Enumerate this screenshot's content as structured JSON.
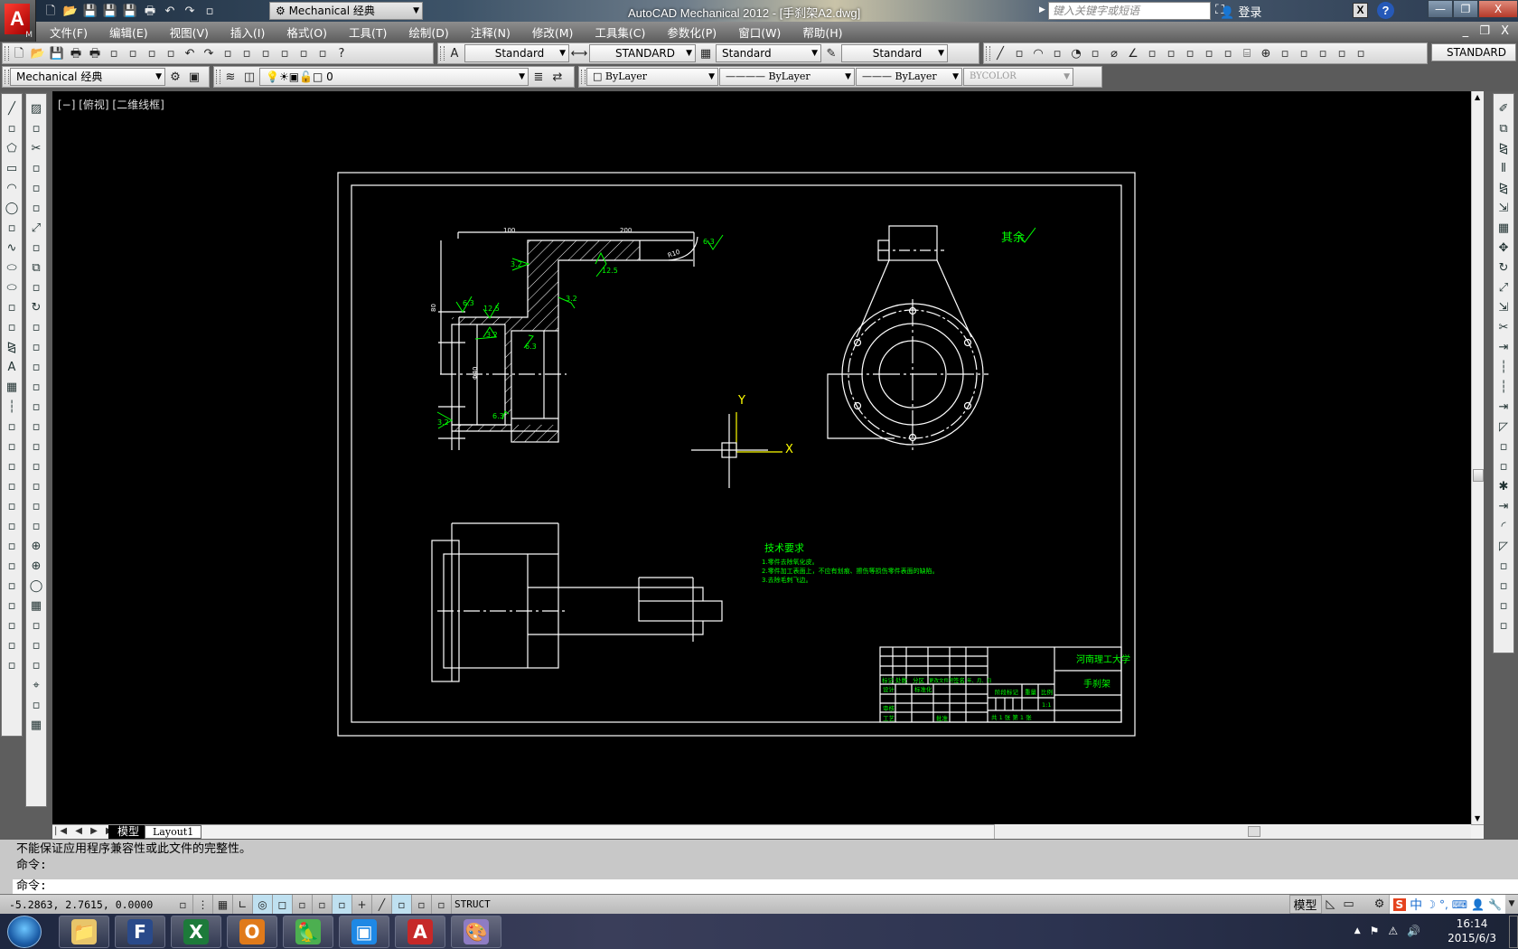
{
  "app": {
    "title": "AutoCAD Mechanical 2012 - [手刹架A2.dwg]",
    "logo_letter": "A",
    "logo_sub": "M",
    "workspace": "Mechanical 经典",
    "search_placeholder": "键入关键字或短语",
    "login": "登录",
    "window_controls": [
      "—",
      "❐",
      "X"
    ],
    "doc_controls": "_ ❐ X"
  },
  "quick_access": [
    "new-icon",
    "open-icon",
    "save-as-icon",
    "save-icon",
    "saveas-edit-icon",
    "plot-icon",
    "undo-icon",
    "redo-icon",
    "workspace-switch-icon"
  ],
  "menu": [
    "文件(F)",
    "编辑(E)",
    "视图(V)",
    "插入(I)",
    "格式(O)",
    "工具(T)",
    "绘制(D)",
    "注释(N)",
    "修改(M)",
    "工具集(C)",
    "参数化(P)",
    "窗口(W)",
    "帮助(H)"
  ],
  "toolbar1": {
    "standard_icons": [
      "new-icon",
      "open-icon",
      "save-icon",
      "plot-icon",
      "plot-preview-icon",
      "publish-icon",
      "3d-print-icon",
      "match-properties-icon",
      "block-editor-icon",
      "undo-icon",
      "redo-icon",
      "properties-icon",
      "design-center-icon",
      "tool-palettes-icon",
      "sheet-set-icon",
      "markup-icon",
      "calculator-icon",
      "help-icon"
    ],
    "text_style": "Standard",
    "dim_style": "STANDARD",
    "table_style": "Standard",
    "mleader_style": "Standard",
    "dim_icons": [
      "linear-dim-icon",
      "aligned-dim-icon",
      "arc-length-icon",
      "ordinate-icon",
      "radius-icon",
      "jogged-icon",
      "diameter-icon",
      "angular-icon",
      "quick-dim-icon",
      "baseline-icon",
      "continue-icon",
      "dim-space-icon",
      "dim-break-icon",
      "tolerance-icon",
      "center-mark-icon",
      "inspection-icon",
      "jogged-linear-icon",
      "dim-edit-icon",
      "dim-text-edit-icon",
      "dim-update-icon"
    ],
    "std_button": "STANDARD"
  },
  "toolbar2": {
    "workspace": "Mechanical 经典",
    "layer": "0",
    "color": "ByLayer",
    "linetype": "ByLayer",
    "lineweight": "ByLayer",
    "plotstyle": "BYCOLOR"
  },
  "viewport_label": "[−] [俯视] [二维线框]",
  "left_toolbar_a": [
    "line-icon",
    "polyline-icon",
    "polygon-icon",
    "rectangle-icon",
    "arc-icon",
    "circle-icon",
    "revcloud-icon",
    "spline-icon",
    "ellipse-icon",
    "ellipse-arc-icon",
    "insert-block-icon",
    "construction-line-icon",
    "mirror-line-icon",
    "text-aa-icon",
    "table-icon",
    "break-line-icon",
    "leader-text-icon",
    "surface-texture-icon",
    "weld-icon",
    "taper-icon",
    "datum-icon",
    "feature-frame-icon",
    "datum-target-icon",
    "datum-id-icon",
    "hole-note-icon",
    "edge-icon",
    "datum-triangle-icon",
    "balloon-icon",
    "balloon-x-icon"
  ],
  "left_toolbar_b": [
    "hatch-icon",
    "dimension-icon",
    "trim-icon",
    "shaft-icon",
    "cut-icon",
    "rect-grip-icon",
    "scale-icon",
    "magnet-icon",
    "copy-icon",
    "edit-icon",
    "rotate-icon",
    "3d-box-icon",
    "library-icon",
    "bolt-icon",
    "beam-icon",
    "bearing-icon",
    "spring-icon",
    "fastener-icon",
    "coil-icon",
    "fea-icon",
    "tee-icon",
    "refresh-icon",
    "center-line-icon",
    "center-cross-icon",
    "circle-center-icon",
    "grid-icon",
    "hole-center-icon",
    "parallel-lines-icon",
    "bolt-circle-icon",
    "target-icon",
    "pattern-icon",
    "array-icon"
  ],
  "right_toolbar": [
    "erase-icon",
    "copy-icon",
    "mirror-copy-icon",
    "offset-icon",
    "mirror-icon",
    "stretch-fill-icon",
    "array-icon",
    "move-icon",
    "rotate-icon",
    "scale-icon",
    "stretch-icon",
    "trim-icon",
    "extend-icon",
    "break-icon",
    "break-point-icon",
    "join-icon",
    "chamfer-circle-icon",
    "power-dim-icon",
    "grip-edit-icon",
    "explode-icon",
    "join-line-icon",
    "fillet-icon",
    "chamfer-icon",
    "corner-icon",
    "corner-line-icon",
    "round-icon",
    "3d-edit-icon"
  ],
  "drawing": {
    "ucs_y": "Y",
    "ucs_x": "X",
    "roughness_other": "其余",
    "dims": {
      "top_left": "100",
      "top_right": "200",
      "left": "80",
      "bore": "Φ40",
      "chamfer": "R10"
    },
    "roughness": [
      "6.3",
      "12.5",
      "3.2",
      "6.3",
      "12.5",
      "3.2",
      "3.2",
      "6.3",
      "3.2",
      "6.3"
    ],
    "tech_req_title": "技术要求",
    "tech_req": [
      "1.零件去除氧化皮。",
      "2.零件加工表面上，不应有划痕、擦伤等损伤零件表面的缺陷。",
      "3.去除毛刺飞边。"
    ],
    "title_block": {
      "school": "河南理工大学",
      "part_name": "手刹架",
      "header_row": [
        "标记",
        "处数",
        "分区",
        "更改文件号",
        "签名",
        "年、月、日"
      ],
      "design": "设计",
      "standardize": "标准化",
      "review": "审核",
      "process": "工艺",
      "approve": "批准",
      "stage_mark": "阶段标记",
      "weight": "重量",
      "scale_label": "比例",
      "scale": "1:1",
      "sheets": "共 1 张  第 1 张"
    }
  },
  "layout_tabs": {
    "nav": "|◀ ◀ ▶ ▶|",
    "model": "模型",
    "layout1": "Layout1"
  },
  "command": {
    "history": [
      "不能保证应用程序兼容性或此文件的完整性。",
      "命令:"
    ],
    "prompt": "命令:"
  },
  "status": {
    "coords": "-5.2863, 2.7615, 0.0000",
    "toggles": [
      {
        "icon": "infer-constraints-icon",
        "on": false
      },
      {
        "icon": "snap-icon",
        "on": false
      },
      {
        "icon": "grid-icon",
        "on": false
      },
      {
        "icon": "ortho-icon",
        "on": false
      },
      {
        "icon": "polar-icon",
        "on": true
      },
      {
        "icon": "osnap-icon",
        "on": true
      },
      {
        "icon": "3d-osnap-icon",
        "on": false
      },
      {
        "icon": "otrack-icon",
        "on": false
      },
      {
        "icon": "ducs-icon",
        "on": true
      },
      {
        "icon": "dyn-icon",
        "on": false
      },
      {
        "icon": "lineweight-icon",
        "on": false
      },
      {
        "icon": "transparency-icon",
        "on": true
      },
      {
        "icon": "quick-properties-icon",
        "on": false
      },
      {
        "icon": "selection-cycling-icon",
        "on": false
      }
    ],
    "struct": "STRUCT",
    "model": "模型",
    "ime_lang": "中"
  },
  "taskbar": {
    "apps": [
      "explorer-icon",
      "foxmail-icon",
      "excel-icon",
      "outlook-icon",
      "parrot-app-icon",
      "window-app-icon",
      "autocad-icon",
      "paint-icon"
    ],
    "time": "16:14",
    "date": "2015/6/3"
  }
}
